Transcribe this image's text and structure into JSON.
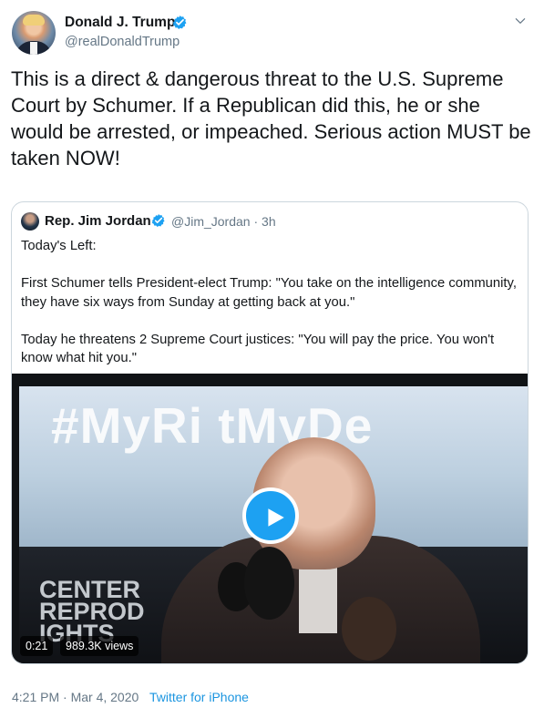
{
  "tweet": {
    "author_name": "Donald J. Trump",
    "author_handle": "@realDonaldTrump",
    "text": "This is a direct & dangerous threat to the U.S. Supreme Court by Schumer. If a Republican did this, he or she would be arrested, or impeached. Serious action MUST be taken NOW!",
    "menu_icon": "chevron-down-icon",
    "accent_color": "#1da1f2"
  },
  "quoted_tweet": {
    "author_name": "Rep. Jim Jordan",
    "author_handle": "@Jim_Jordan",
    "time": "3h",
    "paragraphs": [
      "Today's Left:",
      "First Schumer tells President-elect Trump: \"You take on the intelligence community, they have six ways from Sunday at getting back at you.\"",
      "Today he threatens 2 Supreme Court justices: \"You will pay the price. You won't know what hit you.\""
    ],
    "video": {
      "banner_text": "#MyRi  tMyDe",
      "lower_text": "CENTER\nREPROD\nIGHTS",
      "duration": "0:21",
      "views": "989.3K views",
      "play_icon": "play-icon"
    }
  },
  "footer": {
    "time": "4:21 PM · Mar 4, 2020",
    "separator": "·",
    "source": "Twitter for iPhone"
  }
}
